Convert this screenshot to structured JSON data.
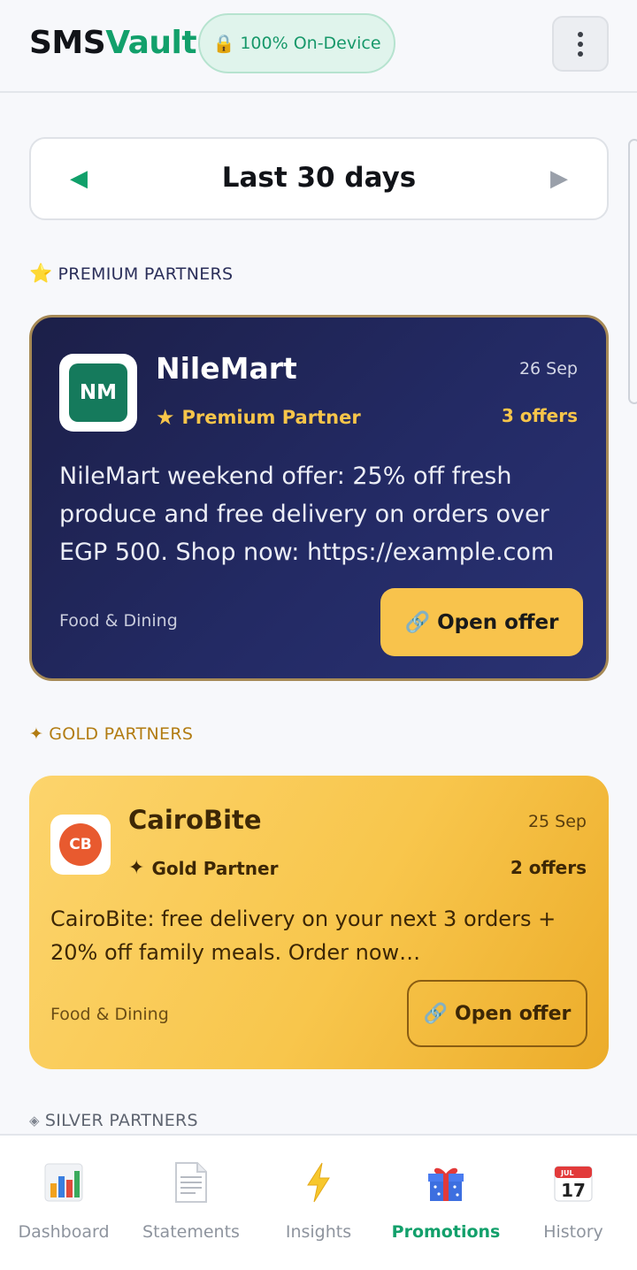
{
  "header": {
    "brand_part1": "SMS",
    "brand_part2": "Vault",
    "badge_icon": "lock-icon",
    "badge_text": "100% On-Device",
    "menu_icon": "more-vertical-icon"
  },
  "range": {
    "label": "Last 30 days",
    "prev_icon": "◀",
    "next_icon": "▶"
  },
  "sections": {
    "premium": "PREMIUM PARTNERS",
    "gold": "GOLD PARTNERS",
    "silver": "SILVER PARTNERS"
  },
  "premium_card": {
    "logo_text": "NM",
    "name": "NileMart",
    "date": "26 Sep",
    "tier": "Premium Partner",
    "offers": "3 offers",
    "message": "NileMart weekend offer: 25% off fresh produce and free delivery on orders over EGP 500. Shop now: https://example.com",
    "category": "Food & Dining",
    "button_label": "Open offer"
  },
  "gold_card": {
    "logo_text": "CB",
    "name": "CairoBite",
    "date": "25 Sep",
    "tier": "Gold Partner",
    "offers": "2 offers",
    "message": "CairoBite: free delivery on your next 3 orders + 20% off family meals. Order now https://example.com",
    "category": "Food & Dining",
    "button_label": "Open offer"
  },
  "nav": {
    "items": [
      {
        "label": "Dashboard",
        "icon": "bar-chart-icon"
      },
      {
        "label": "Statements",
        "icon": "document-icon"
      },
      {
        "label": "Insights",
        "icon": "lightning-icon"
      },
      {
        "label": "Promotions",
        "icon": "gift-icon"
      },
      {
        "label": "History",
        "icon": "calendar-icon"
      }
    ],
    "active": "Promotions",
    "calendar_month": "JUL",
    "calendar_day": "17"
  },
  "colors": {
    "accent": "#12a06b",
    "premium_bg": "#1f2456",
    "premium_gold": "#f7c54a",
    "gold_bg": "#f8c64c"
  }
}
